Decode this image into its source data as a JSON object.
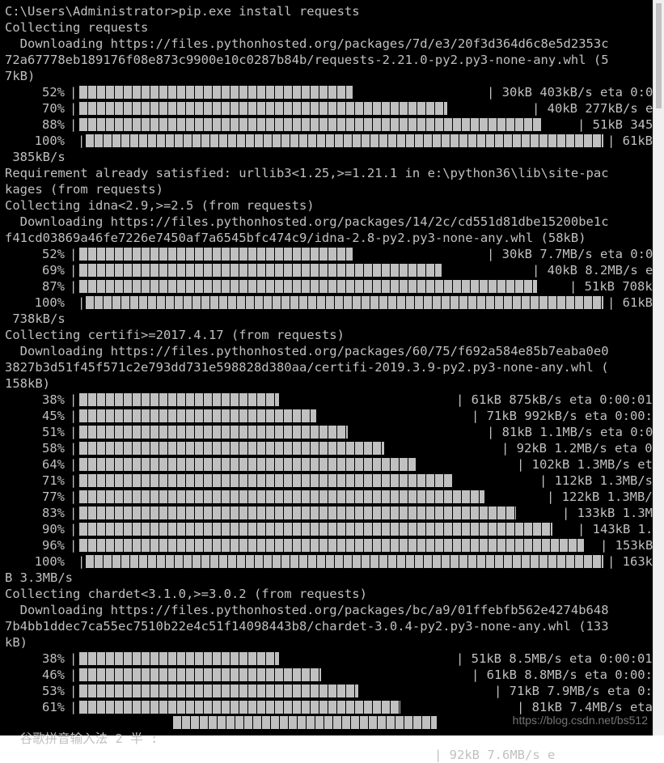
{
  "console": {
    "lines": [
      {
        "type": "text",
        "text": "C:\\Users\\Administrator>pip.exe install requests"
      },
      {
        "type": "text",
        "text": "Collecting requests"
      },
      {
        "type": "text",
        "text": "  Downloading https://files.pythonhosted.org/packages/7d/e3/20f3d364d6c8e5d2353c"
      },
      {
        "type": "text",
        "text": "72a67778eb189176f08e873c9900e10c0287b84b/requests-2.21.0-py2.py3-none-any.whl (5"
      },
      {
        "type": "text",
        "text": "7kB)"
      },
      {
        "type": "progress",
        "pct": "52%",
        "fill": 0.52,
        "tail": "| 30kB 403kB/s eta 0:0"
      },
      {
        "type": "progress",
        "pct": "70%",
        "fill": 0.7,
        "tail": "| 40kB 277kB/s e"
      },
      {
        "type": "progress",
        "pct": "88%",
        "fill": 0.88,
        "tail": "| 51kB 345"
      },
      {
        "type": "progress",
        "pct": "100%",
        "fill": 1.0,
        "tail": "| 61kB"
      },
      {
        "type": "text",
        "text": " 385kB/s"
      },
      {
        "type": "text",
        "text": "Requirement already satisfied: urllib3<1.25,>=1.21.1 in e:\\python36\\lib\\site-pac"
      },
      {
        "type": "text",
        "text": "kages (from requests)"
      },
      {
        "type": "text",
        "text": "Collecting idna<2.9,>=2.5 (from requests)"
      },
      {
        "type": "text",
        "text": "  Downloading https://files.pythonhosted.org/packages/14/2c/cd551d81dbe15200be1c"
      },
      {
        "type": "text",
        "text": "f41cd03869a46fe7226e7450af7a6545bfc474c9/idna-2.8-py2.py3-none-any.whl (58kB)"
      },
      {
        "type": "progress",
        "pct": "52%",
        "fill": 0.52,
        "tail": "| 30kB 7.7MB/s eta 0:0"
      },
      {
        "type": "progress",
        "pct": "69%",
        "fill": 0.69,
        "tail": "| 40kB 8.2MB/s e"
      },
      {
        "type": "progress",
        "pct": "87%",
        "fill": 0.87,
        "tail": "| 51kB 708k"
      },
      {
        "type": "progress",
        "pct": "100%",
        "fill": 1.0,
        "tail": "| 61kB"
      },
      {
        "type": "text",
        "text": " 738kB/s"
      },
      {
        "type": "text",
        "text": "Collecting certifi>=2017.4.17 (from requests)"
      },
      {
        "type": "text",
        "text": "  Downloading https://files.pythonhosted.org/packages/60/75/f692a584e85b7eaba0e0"
      },
      {
        "type": "text",
        "text": "3827b3d51f45f571c2e793dd731e598828d380aa/certifi-2019.3.9-py2.py3-none-any.whl ("
      },
      {
        "type": "text",
        "text": "158kB)"
      },
      {
        "type": "progress",
        "pct": "38%",
        "fill": 0.38,
        "tail": "| 61kB 875kB/s eta 0:00:01"
      },
      {
        "type": "progress",
        "pct": "45%",
        "fill": 0.45,
        "tail": "| 71kB 992kB/s eta 0:00:"
      },
      {
        "type": "progress",
        "pct": "51%",
        "fill": 0.51,
        "tail": "| 81kB 1.1MB/s eta 0:0"
      },
      {
        "type": "progress",
        "pct": "58%",
        "fill": 0.58,
        "tail": "| 92kB 1.2MB/s eta 0"
      },
      {
        "type": "progress",
        "pct": "64%",
        "fill": 0.64,
        "tail": "| 102kB 1.3MB/s et"
      },
      {
        "type": "progress",
        "pct": "71%",
        "fill": 0.71,
        "tail": "| 112kB 1.3MB/s"
      },
      {
        "type": "progress",
        "pct": "77%",
        "fill": 0.77,
        "tail": "| 122kB 1.3MB/"
      },
      {
        "type": "progress",
        "pct": "83%",
        "fill": 0.83,
        "tail": "| 133kB 1.3M"
      },
      {
        "type": "progress",
        "pct": "90%",
        "fill": 0.9,
        "tail": "| 143kB 1."
      },
      {
        "type": "progress",
        "pct": "96%",
        "fill": 0.96,
        "tail": "| 153kB"
      },
      {
        "type": "progress",
        "pct": "100%",
        "fill": 1.0,
        "tail": "| 163k"
      },
      {
        "type": "text",
        "text": "B 3.3MB/s"
      },
      {
        "type": "text",
        "text": "Collecting chardet<3.1.0,>=3.0.2 (from requests)"
      },
      {
        "type": "text",
        "text": "  Downloading https://files.pythonhosted.org/packages/bc/a9/01ffebfb562e4274b648"
      },
      {
        "type": "text",
        "text": "7b4bb1ddec7ca55ec7510b22e4c51f14098443b8/chardet-3.0.4-py2.py3-none-any.whl (133"
      },
      {
        "type": "text",
        "text": "kB)"
      },
      {
        "type": "progress",
        "pct": "38%",
        "fill": 0.38,
        "tail": "| 51kB 8.5MB/s eta 0:00:01"
      },
      {
        "type": "progress",
        "pct": "46%",
        "fill": 0.46,
        "tail": "| 61kB 8.8MB/s eta 0:00:"
      },
      {
        "type": "progress",
        "pct": "53%",
        "fill": 0.53,
        "tail": "| 71kB 7.9MB/s eta 0:"
      },
      {
        "type": "progress",
        "pct": "61%",
        "fill": 0.61,
        "tail": "| 81kB 7.4MB/s eta"
      }
    ]
  },
  "ime": {
    "label": "谷歌拼音输入法 2 半 :",
    "progress_fill": 0.68,
    "tail": "| 92kB 7.6MB/s e"
  },
  "watermark": {
    "text": "https://blog.csdn.net/bs512"
  },
  "colors": {
    "console_bg": "#000000",
    "console_text": "#c0c0c0",
    "scrollbar_bg": "#f0f0f0"
  }
}
